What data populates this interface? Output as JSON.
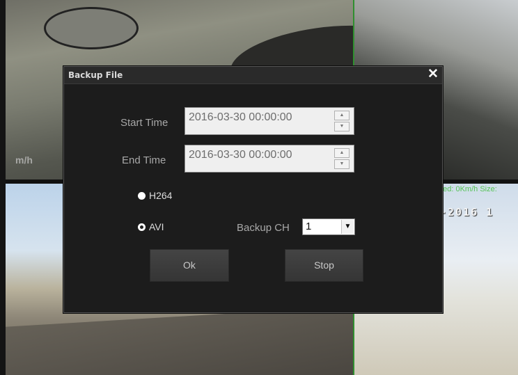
{
  "background": {
    "speed_overlay": "eed: 0Km/h Size:",
    "date_overlay": "-2016  1",
    "kmh_overlay": "m/h"
  },
  "dialog": {
    "title": "Backup File",
    "close_glyph": "✕",
    "start_time": {
      "label": "Start Time",
      "value": "2016-03-30 00:00:00"
    },
    "end_time": {
      "label": "End Time",
      "value": "2016-03-30 00:00:00"
    },
    "format_options": [
      {
        "label": "H264",
        "selected": false
      },
      {
        "label": "AVI",
        "selected": true
      }
    ],
    "backup_ch": {
      "label": "Backup CH",
      "value": "1"
    },
    "buttons": {
      "ok": "Ok",
      "stop": "Stop"
    }
  },
  "colors": {
    "overlay_green": "#56c356",
    "dialog_bg": "#1c1c1c",
    "button_bg": "#3d3d3d"
  },
  "icons": {
    "close": "close-icon",
    "spin_up": "spin-up-icon",
    "spin_down": "spin-down-icon",
    "dropdown": "chevron-down-icon"
  }
}
